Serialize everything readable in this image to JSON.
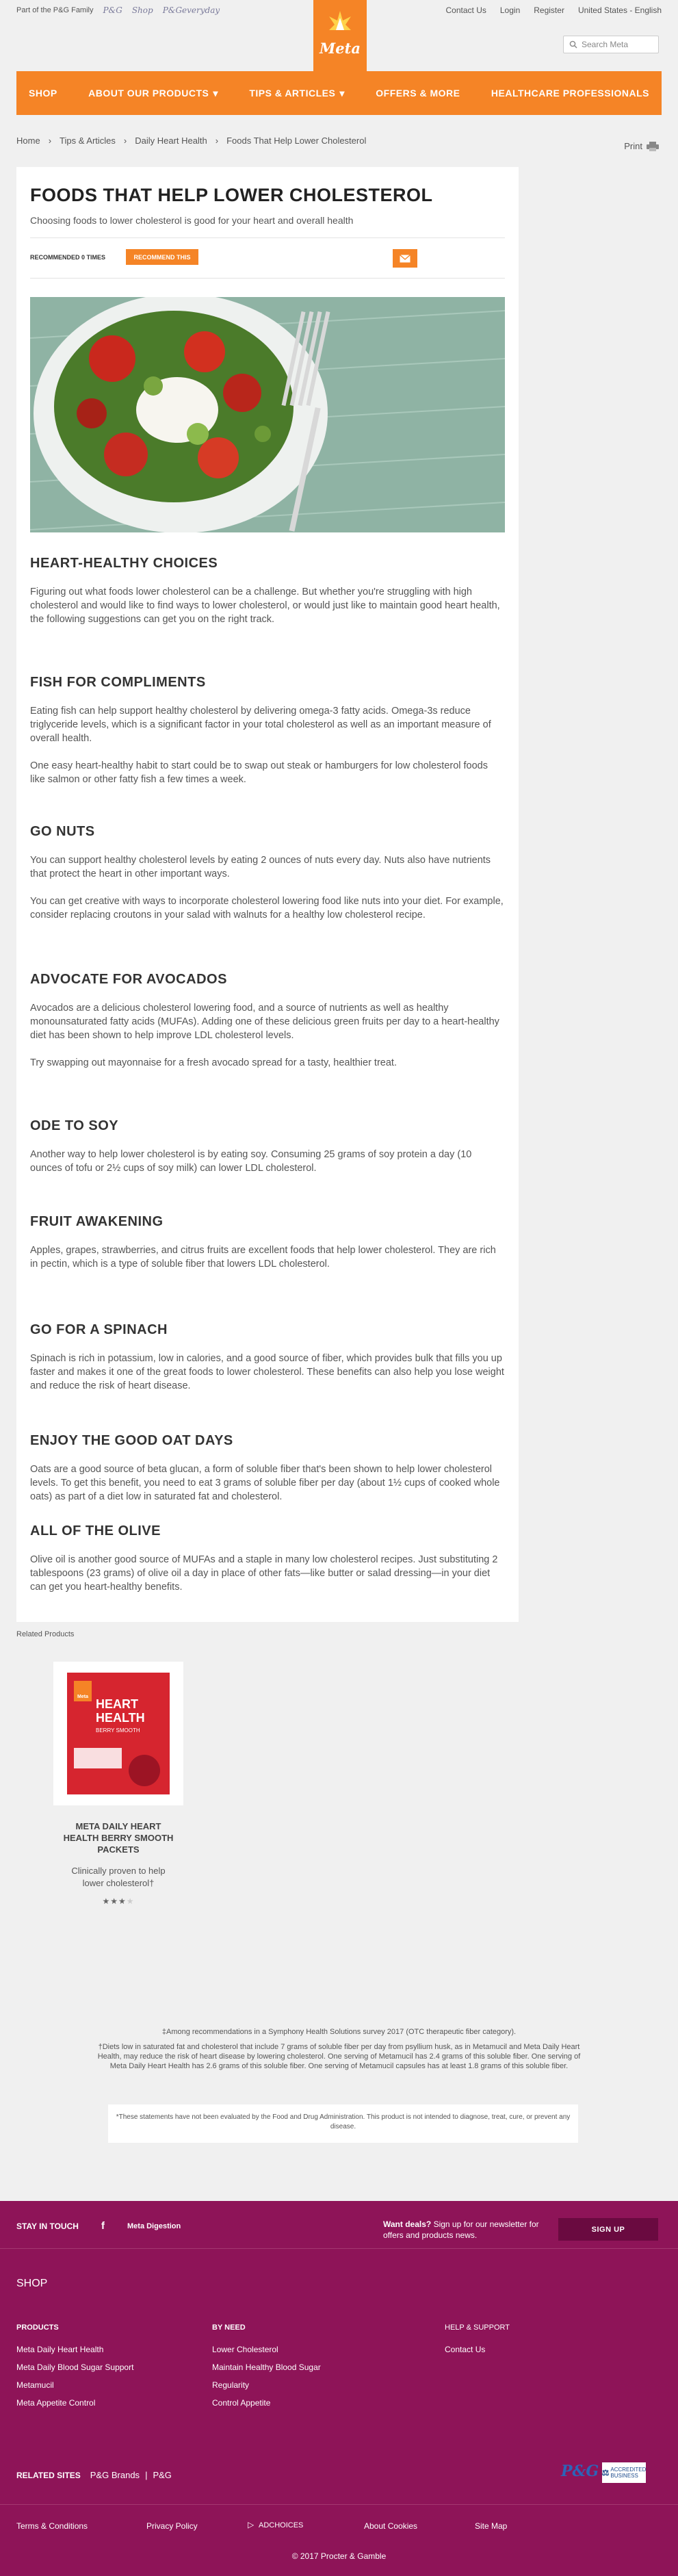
{
  "topbar": {
    "family": "Part of the P&G Family",
    "pg": "P&G",
    "shop": "Shop",
    "everyday": "P&Geveryday",
    "contact": "Contact Us",
    "login": "Login",
    "register": "Register",
    "locale": "United States - English"
  },
  "logo": {
    "text": "Meta"
  },
  "search": {
    "placeholder": "Search Meta"
  },
  "nav": [
    "SHOP",
    "ABOUT OUR PRODUCTS",
    "TIPS & ARTICLES",
    "OFFERS & MORE",
    "HEALTHCARE PROFESSIONALS"
  ],
  "breadcrumb": [
    "Home",
    "Tips & Articles",
    "Daily Heart Health",
    "Foods That Help Lower Cholesterol"
  ],
  "print": "Print",
  "article": {
    "title": "FOODS THAT HELP LOWER CHOLESTEROL",
    "subtitle": "Choosing foods to lower cholesterol is good for your heart and overall health",
    "recommended": "RECOMMENDED 0 TIMES",
    "recommend_btn": "RECOMMEND THIS",
    "sections": [
      {
        "h": "HEART-HEALTHY CHOICES",
        "p": [
          "Figuring out what foods lower cholesterol can be a challenge. But whether you're struggling with high cholesterol and would like to find ways to lower cholesterol, or would just like to maintain good heart health, the following suggestions can get you on the right track."
        ]
      },
      {
        "h": "FISH FOR COMPLIMENTS",
        "p": [
          "Eating fish can help support healthy cholesterol by delivering omega-3 fatty acids. Omega-3s reduce triglyceride levels, which is a significant factor in your total cholesterol as well as an important measure of overall health.",
          "One easy heart-healthy habit to start could be to swap out steak or hamburgers for low cholesterol foods like salmon or other fatty fish a few times a week."
        ]
      },
      {
        "h": "GO NUTS",
        "p": [
          "You can support healthy cholesterol levels by eating 2 ounces of nuts every day. Nuts also have nutrients that protect the heart in other important ways.",
          "You can get creative with ways to incorporate cholesterol lowering food like nuts into your diet. For example, consider replacing croutons in your salad with walnuts for a healthy low cholesterol recipe."
        ]
      },
      {
        "h": "ADVOCATE FOR AVOCADOS",
        "p": [
          "Avocados are a delicious cholesterol lowering food, and a source of nutrients as well as healthy monounsaturated fatty acids (MUFAs). Adding one of these delicious green fruits per day to a heart-healthy diet has been shown to help improve LDL cholesterol levels.",
          "Try swapping out mayonnaise for a fresh avocado spread for a tasty, healthier treat."
        ]
      },
      {
        "h": "ODE TO SOY",
        "p": [
          "Another way to help lower cholesterol is by eating soy. Consuming 25 grams of soy protein a day (10 ounces of tofu or 2½ cups of soy milk) can lower LDL cholesterol."
        ]
      },
      {
        "h": "FRUIT AWAKENING",
        "p": [
          "Apples, grapes, strawberries, and citrus fruits are excellent foods that help lower cholesterol. They are rich in pectin, which is a type of soluble fiber that lowers LDL cholesterol."
        ]
      },
      {
        "h": "GO FOR A SPINACH",
        "p": [
          "Spinach is rich in potassium, low in calories, and a good source of fiber, which provides bulk that fills you up faster and makes it one of the great foods to lower cholesterol. These benefits can also help you lose weight and reduce the risk of heart disease."
        ]
      },
      {
        "h": "ENJOY THE GOOD OAT DAYS",
        "p": [
          "Oats are a good source of beta glucan, a form of soluble fiber that's been shown to help lower cholesterol levels. To get this benefit, you need to eat 3 grams of soluble fiber per day (about 1½ cups of cooked whole oats) as part of a diet low in saturated fat and cholesterol."
        ]
      },
      {
        "h": "ALL OF THE OLIVE",
        "p": [
          "Olive oil is another good source of MUFAs and a staple in many low cholesterol recipes. Just substituting 2 tablespoons (23 grams) of olive oil a day in place of other fats—like butter or salad dressing—in your diet can get you heart-healthy benefits."
        ]
      }
    ]
  },
  "related": {
    "title": "Related Products",
    "pkg_brand": "Meta",
    "pkg_line1": "HEART",
    "pkg_line2": "HEALTH",
    "pkg_flavor": "BERRY SMOOTH",
    "name": "META DAILY HEART HEALTH BERRY SMOOTH PACKETS",
    "desc": "Clinically proven to help lower cholesterol†",
    "rating": 3
  },
  "footnotes": {
    "n1": "‡Among recommendations in a Symphony Health Solutions survey 2017 (OTC therapeutic fiber category).",
    "n2": "†Diets low in saturated fat and cholesterol that include 7 grams of soluble fiber per day from psyllium husk, as in Metamucil and Meta Daily Heart Health, may reduce the risk of heart disease by lowering cholesterol. One serving of Metamucil has 2.4 grams of this soluble fiber. One serving of Meta Daily Heart Health has 2.6 grams of this soluble fiber. One serving of Metamucil capsules has at least 1.8 grams of this soluble fiber.",
    "disclaimer": "*These statements have not been evaluated by the Food and Drug Administration. This product is not intended to diagnose, treat, cure, or prevent any disease."
  },
  "footer": {
    "stay": "STAY IN TOUCH",
    "fb": "f",
    "md": "Meta Digestion",
    "deals_q": "Want deals?",
    "deals_t": " Sign up for our newsletter for",
    "deals_t2": "offers and products news.",
    "signup": "SIGN UP",
    "shop": "SHOP",
    "cols": [
      {
        "h": "PRODUCTS",
        "items": [
          "Meta Daily Heart Health",
          "Meta Daily Blood Sugar Support",
          "Metamucil",
          "Meta Appetite Control"
        ]
      },
      {
        "h": "BY NEED",
        "items": [
          "Lower Cholesterol",
          "Maintain Healthy Blood Sugar",
          "Regularity",
          "Control Appetite"
        ]
      },
      {
        "h": "HELP & SUPPORT",
        "items": [
          "Contact Us"
        ]
      }
    ],
    "related_sites": "RELATED SITES",
    "pgbrands": "P&G Brands",
    "pg": "P&G",
    "pglogo": "P&G",
    "bbb": "ACCREDITED BUSINESS",
    "links": [
      "Terms & Conditions",
      "Privacy Policy",
      "ADCHOICES",
      "About Cookies",
      "Site Map"
    ],
    "copy": "© 2017 Procter & Gamble"
  },
  "colors": {
    "brand": "#f58426",
    "footer": "#8e1458"
  }
}
